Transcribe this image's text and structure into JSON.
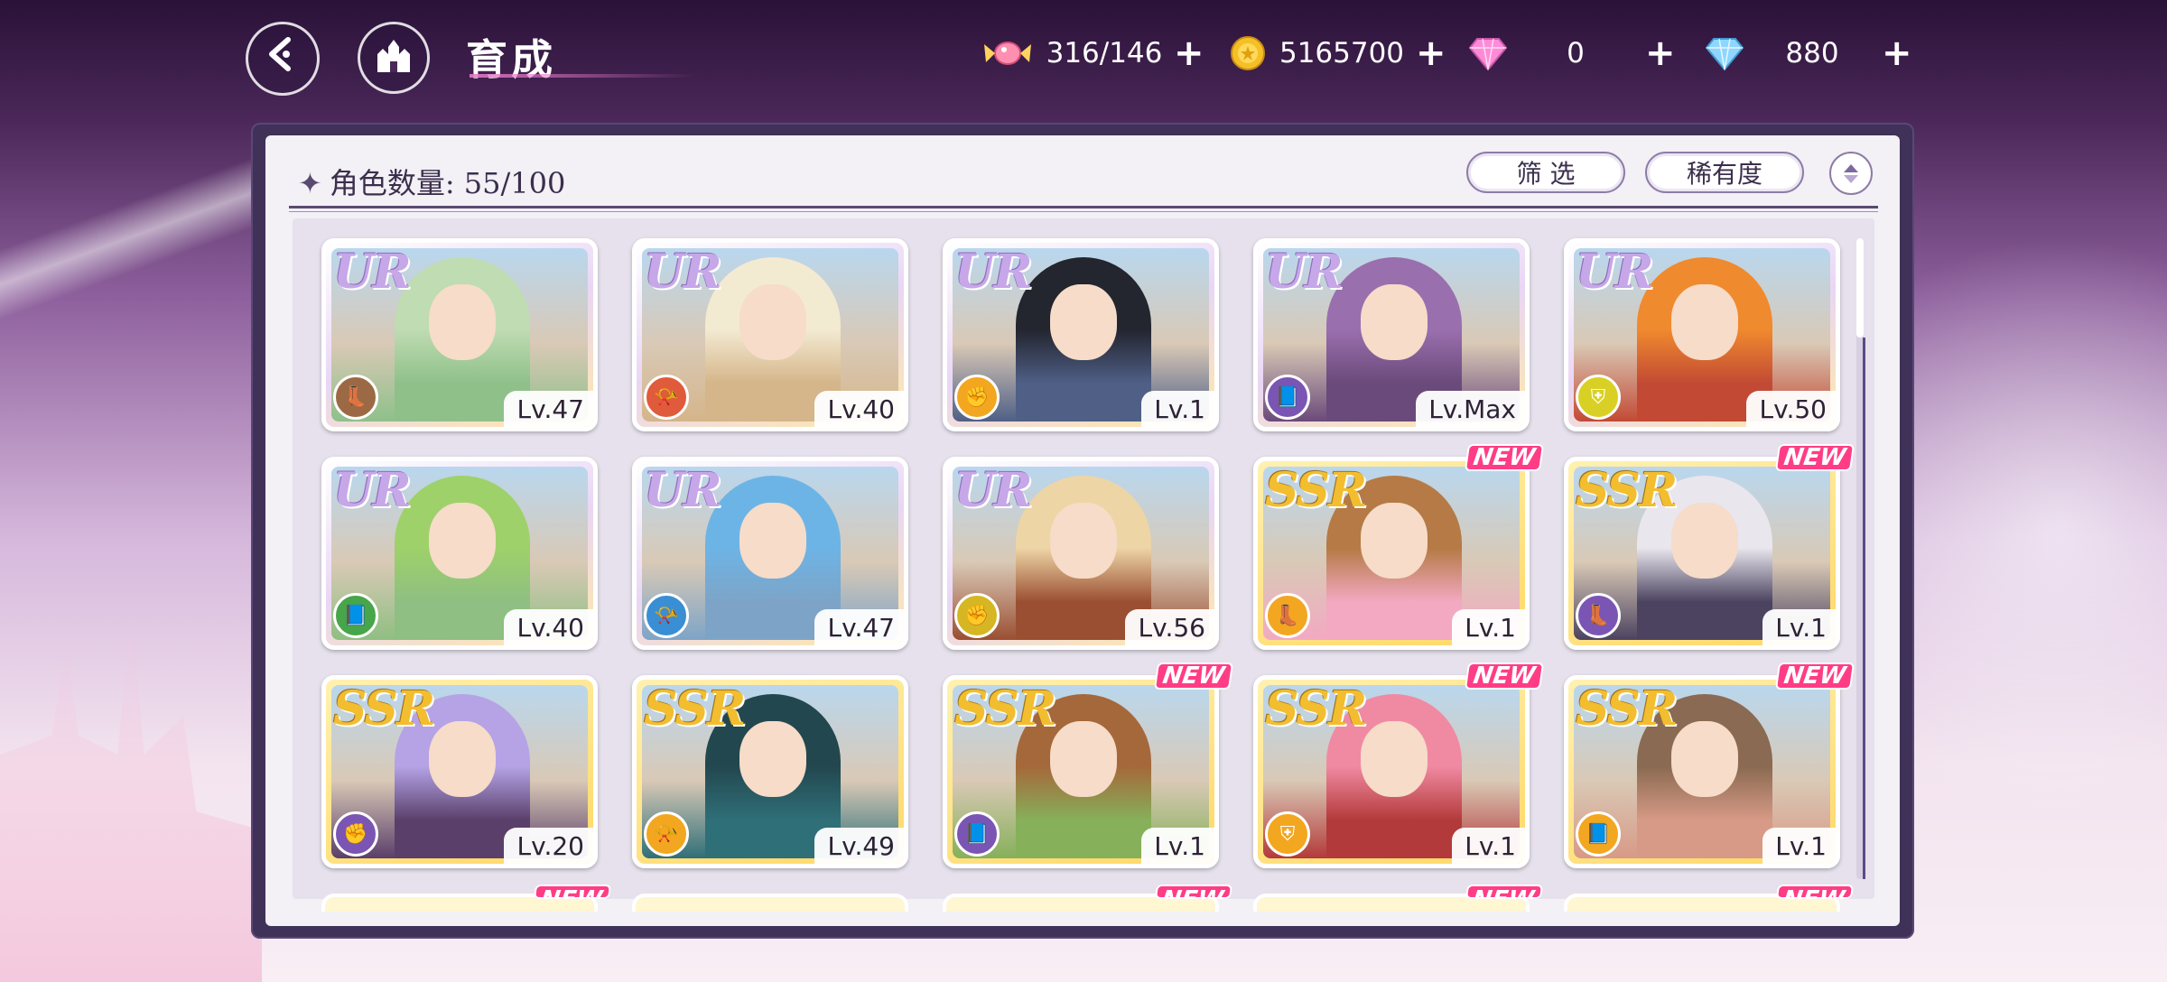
{
  "header": {
    "title": "育成",
    "resources": [
      {
        "name": "candy",
        "value": "316/146",
        "icon": "candy-icon"
      },
      {
        "name": "gold-coin",
        "value": "5165700",
        "icon": "coin-icon"
      },
      {
        "name": "pink-diamond",
        "value": "0",
        "icon": "pink-diamond-icon"
      },
      {
        "name": "blue-diamond",
        "value": "880",
        "icon": "blue-diamond-icon"
      }
    ],
    "plus": "+"
  },
  "panel": {
    "count_label": "角色数量: 55/100",
    "filter_label": "筛 选",
    "rarity_label": "稀有度"
  },
  "cards": [
    {
      "rarity": "UR",
      "level": "Lv.47",
      "role_icon": "boot-icon",
      "role_color": "#9b6a45",
      "is_new": false,
      "tint": "#8fc08a",
      "hair": "#bfdcb2"
    },
    {
      "rarity": "UR",
      "level": "Lv.40",
      "role_icon": "horn-icon",
      "role_color": "#e05a3c",
      "is_new": false,
      "tint": "#d5b58a",
      "hair": "#f3ead2"
    },
    {
      "rarity": "UR",
      "level": "Lv.1",
      "role_icon": "fist-icon",
      "role_color": "#f3a620",
      "is_new": false,
      "tint": "#4f5f86",
      "hair": "#23252f"
    },
    {
      "rarity": "UR",
      "level": "Lv.Max",
      "role_icon": "book-icon",
      "role_color": "#7b55b3",
      "is_new": false,
      "tint": "#6a4a7a",
      "hair": "#9a6fae"
    },
    {
      "rarity": "UR",
      "level": "Lv.50",
      "role_icon": "shield-icon",
      "role_color": "#d9d026",
      "is_new": false,
      "tint": "#c24a34",
      "hair": "#f08a2e"
    },
    {
      "rarity": "UR",
      "level": "Lv.40",
      "role_icon": "book-icon",
      "role_color": "#47a54a",
      "is_new": false,
      "tint": "#8fbf82",
      "hair": "#9ed16a"
    },
    {
      "rarity": "UR",
      "level": "Lv.47",
      "role_icon": "horn-icon",
      "role_color": "#3a8ed3",
      "is_new": false,
      "tint": "#7da4c7",
      "hair": "#6db4e6"
    },
    {
      "rarity": "UR",
      "level": "Lv.56",
      "role_icon": "fist-icon",
      "role_color": "#d6b622",
      "is_new": false,
      "tint": "#9a4f32",
      "hair": "#eed5a6"
    },
    {
      "rarity": "SSR",
      "level": "Lv.1",
      "role_icon": "boot-icon",
      "role_color": "#f3a620",
      "is_new": true,
      "tint": "#f3a9c2",
      "hair": "#b57a45"
    },
    {
      "rarity": "SSR",
      "level": "Lv.1",
      "role_icon": "boot-icon",
      "role_color": "#7b55b3",
      "is_new": true,
      "tint": "#4b4360",
      "hair": "#e9e6ee"
    },
    {
      "rarity": "SSR",
      "level": "Lv.20",
      "role_icon": "fist-icon",
      "role_color": "#7b55b3",
      "is_new": false,
      "tint": "#5a3f6a",
      "hair": "#b5a3e6"
    },
    {
      "rarity": "SSR",
      "level": "Lv.49",
      "role_icon": "horn-icon",
      "role_color": "#f3a620",
      "is_new": false,
      "tint": "#2f6f78",
      "hair": "#23474f"
    },
    {
      "rarity": "SSR",
      "level": "Lv.1",
      "role_icon": "book-icon",
      "role_color": "#7b55b3",
      "is_new": true,
      "tint": "#86b05a",
      "hair": "#a5683a"
    },
    {
      "rarity": "SSR",
      "level": "Lv.1",
      "role_icon": "shield-icon",
      "role_color": "#f3a620",
      "is_new": true,
      "tint": "#b33a3a",
      "hair": "#f08aa2"
    },
    {
      "rarity": "SSR",
      "level": "Lv.1",
      "role_icon": "book-icon",
      "role_color": "#f3a620",
      "is_new": true,
      "tint": "#d79a86",
      "hair": "#8a6a52"
    }
  ],
  "new_label": "NEW",
  "peek_row_new": [
    true,
    false,
    true,
    true,
    true
  ]
}
